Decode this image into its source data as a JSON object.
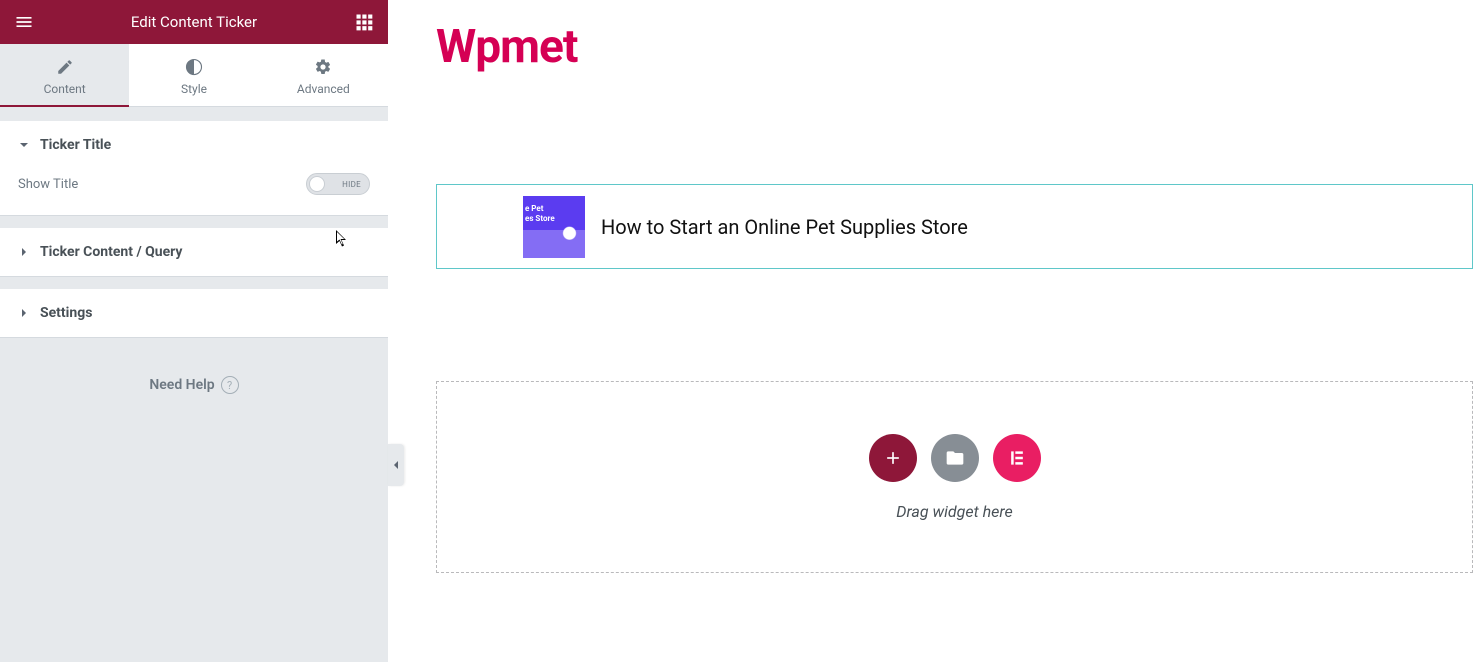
{
  "panel": {
    "title": "Edit Content Ticker",
    "tabs": {
      "content": "Content",
      "style": "Style",
      "advanced": "Advanced"
    },
    "sections": {
      "ticker_title": {
        "label": "Ticker Title",
        "show_title_label": "Show Title",
        "toggle_text": "HIDE"
      },
      "ticker_content": "Ticker Content / Query",
      "settings": "Settings"
    },
    "help": "Need Help"
  },
  "preview": {
    "brand": "Wpmet",
    "ticker_item": "How to Start an Online Pet Supplies Store",
    "drop_text": "Drag widget here"
  },
  "icons": {
    "hamburger": "hamburger-icon",
    "grid": "grid-icon",
    "pencil": "pencil-icon",
    "half": "half-circle-icon",
    "gear": "gear-icon",
    "chev_down": "chevron-down-icon",
    "chev_right": "chevron-right-icon",
    "chev_left": "chevron-left-icon",
    "question": "question-icon",
    "plus": "plus-icon",
    "folder": "folder-icon",
    "ek": "ek-icon"
  },
  "colors": {
    "accent_dark": "#8e1739",
    "accent_pink": "#d50054",
    "teal": "#5fc7c9",
    "grey": "#878e95",
    "magenta": "#e91e63"
  }
}
